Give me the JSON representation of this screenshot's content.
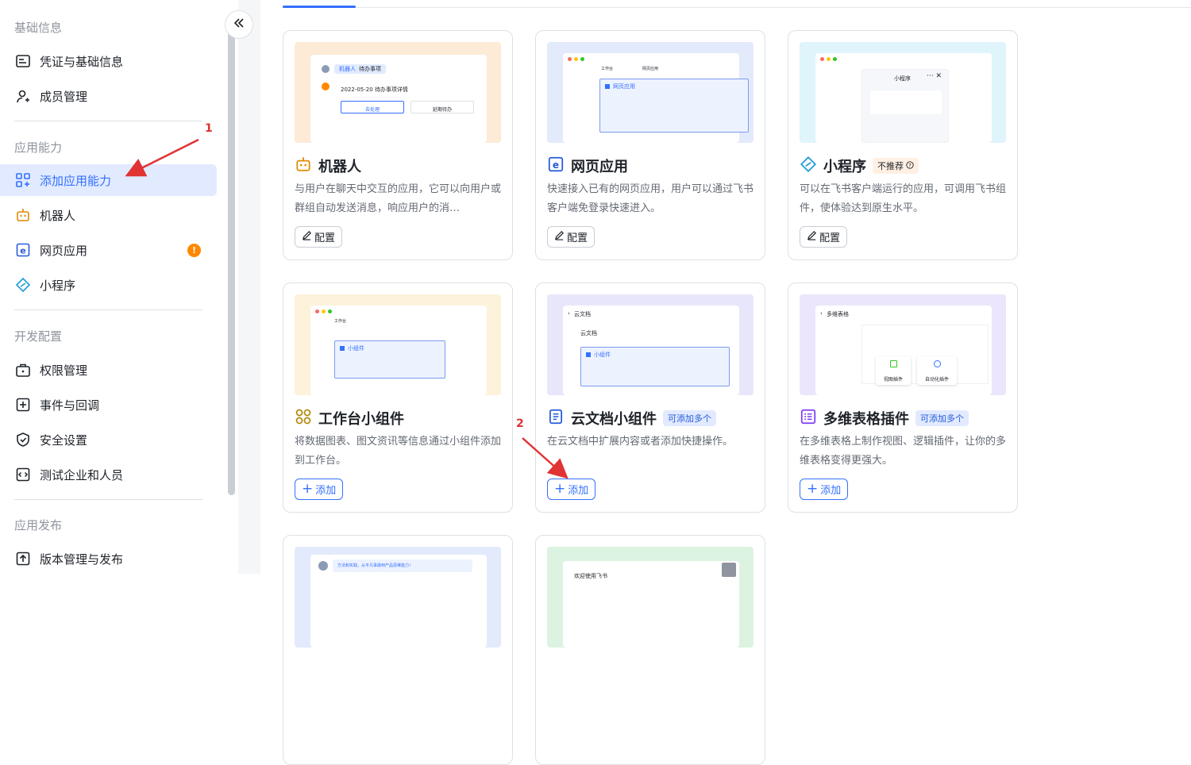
{
  "sidebar": {
    "sections": [
      {
        "title": "基础信息"
      },
      {
        "title": "应用能力"
      },
      {
        "title": "开发配置"
      },
      {
        "title": "应用发布"
      }
    ],
    "items": [
      {
        "label": "凭证与基础信息"
      },
      {
        "label": "成员管理"
      },
      {
        "label": "添加应用能力"
      },
      {
        "label": "机器人"
      },
      {
        "label": "网页应用",
        "badge": "!"
      },
      {
        "label": "小程序"
      },
      {
        "label": "权限管理"
      },
      {
        "label": "事件与回调"
      },
      {
        "label": "安全设置"
      },
      {
        "label": "测试企业和人员"
      },
      {
        "label": "版本管理与发布"
      }
    ]
  },
  "annotations": {
    "one": "1",
    "two": "2"
  },
  "cards": [
    {
      "title": "机器人",
      "desc": "与用户在聊天中交互的应用，它可以向用户或群组自动发送消息，响应用户的消…",
      "button": "配置",
      "preview": {
        "tag": "机器人",
        "title": "待办事项",
        "line": "2022-05-20 待办事项详情",
        "btn1": "去处理",
        "btn2": "延期待办"
      }
    },
    {
      "title": "网页应用",
      "desc": "快速接入已有的网页应用，用户可以通过飞书客户端免登录快速进入。",
      "button": "配置",
      "preview": {
        "tab1": "工作台",
        "tab2": "网页应用",
        "box": "网页应用"
      }
    },
    {
      "title": "小程序",
      "tag": "不推荐",
      "desc": "可以在飞书客户端运行的应用，可调用飞书组件，使体验达到原生水平。",
      "button": "配置",
      "preview": {
        "popup": "小程序"
      }
    },
    {
      "title": "工作台小组件",
      "desc": "将数据图表、图文资讯等信息通过小组件添加到工作台。",
      "button": "添加",
      "preview": {
        "tab": "工作台",
        "box": "小组件"
      }
    },
    {
      "title": "云文档小组件",
      "tag": "可添加多个",
      "desc": "在云文档中扩展内容或者添加快捷操作。",
      "button": "添加",
      "preview": {
        "header": "云文档",
        "doc": "云文档",
        "box": "小组件"
      }
    },
    {
      "title": "多维表格插件",
      "tag": "可添加多个",
      "desc": "在多维表格上制作视图、逻辑插件，让你的多维表格变得更强大。",
      "button": "添加",
      "preview": {
        "header": "多维表格",
        "plugin1": "视图插件",
        "plugin2": "自动化插件"
      }
    },
    {
      "preview": {
        "hint": "方法和实践，从平凡事做到产品思维能力！"
      }
    },
    {
      "preview": {
        "welcome": "欢迎使用飞书"
      }
    }
  ],
  "colors": {
    "accent": "#3370ff",
    "active_bg": "#e1eaff",
    "warn": "#ff8800",
    "annotation": "#e03333"
  }
}
